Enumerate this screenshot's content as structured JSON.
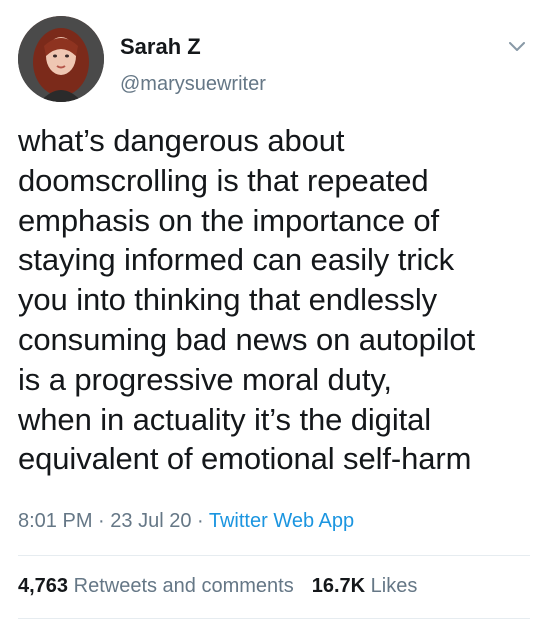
{
  "author": {
    "name": "Sarah Z",
    "handle": "@marysuewriter"
  },
  "tweet": {
    "lines": [
      "what’s dangerous about",
      "doomscrolling is that repeated",
      "emphasis on the importance of",
      "staying informed can easily trick",
      "you into thinking that endlessly",
      "consuming bad news on autopilot",
      "is a progressive moral duty,",
      "when in actuality it’s the digital",
      "equivalent of emotional self-harm"
    ]
  },
  "meta": {
    "time": "8:01 PM",
    "sep1": " · ",
    "date": "23 Jul 20",
    "sep2": " · ",
    "app": "Twitter Web App"
  },
  "stats": {
    "retweets_count": "4,763",
    "retweets_label": "Retweets and comments",
    "likes_count": "16.7K",
    "likes_label": "Likes"
  },
  "icons": {
    "menu": "chevron-down-icon"
  },
  "colors": {
    "text": "#14171a",
    "secondary": "#657786",
    "link": "#1b95e0",
    "divider": "#e6ecf0"
  }
}
